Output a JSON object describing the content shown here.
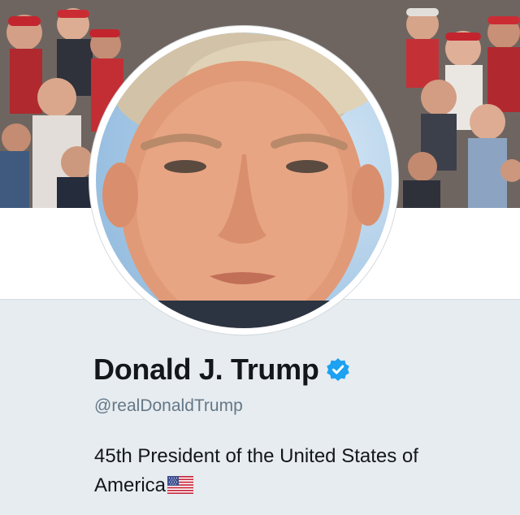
{
  "profile": {
    "display_name": "Donald J. Trump",
    "verified_icon": "verified-badge-icon",
    "handle": "@realDonaldTrump",
    "bio_line1": "45th President of the United States of",
    "bio_line2": "America",
    "bio_emoji": "us-flag-icon"
  },
  "colors": {
    "verified_blue": "#1da1f2",
    "text_primary": "#14171a",
    "text_secondary": "#657786",
    "panel_background": "#e6ecf0"
  }
}
